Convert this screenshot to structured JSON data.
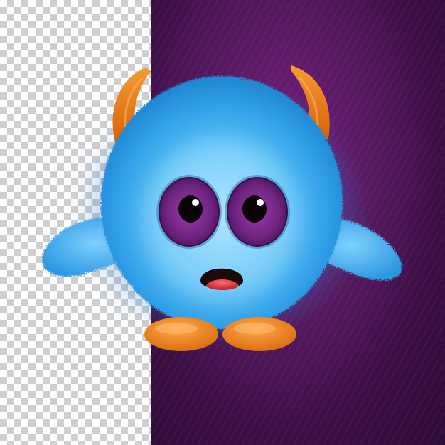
{
  "scene": {
    "subject": "blue-fluffy-monster",
    "colors": {
      "fur": "#3fb0ee",
      "fur_light": "#8fd6ff",
      "horns": "#f07a12",
      "feet": "#f08a20",
      "eye_socket": "#5a1e6a",
      "iris": "#8a2f9a",
      "mouth": "#1b0a0a",
      "tongue": "#e0363a",
      "background_purple": "#4a1352",
      "transparency_checker": "#cfcfcf"
    }
  }
}
